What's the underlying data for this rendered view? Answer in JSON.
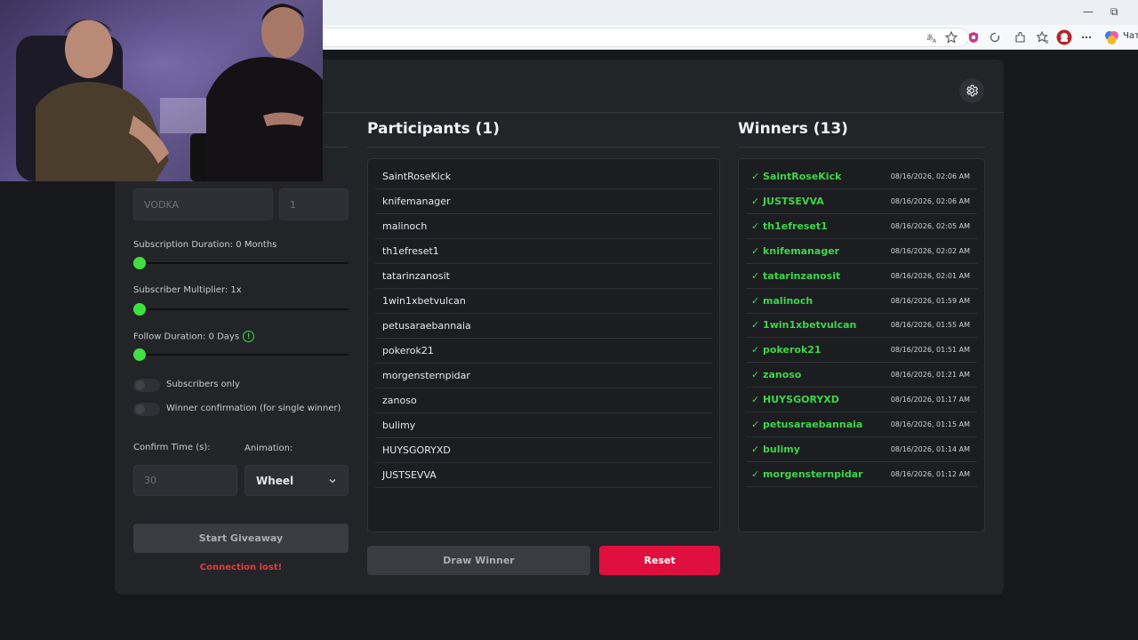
{
  "browser": {
    "window_minimize": "—",
    "window_restore": "⧉",
    "copilot_label": "Чат",
    "toolbar_icons": [
      "translate-icon",
      "favorite-star-icon",
      "extension-icon",
      "refresh-extension-icon",
      "extensions-puzzle-icon",
      "favorites-icon",
      "profile-avatar-icon",
      "more-menu-icon",
      "copilot-icon"
    ]
  },
  "left_panel": {
    "keyword_placeholder": "VODKA",
    "count_placeholder": "1",
    "subscription_duration_label": "Subscription Duration: 0 Months",
    "subscriber_multiplier_label": "Subscriber Multiplier: 1x",
    "follow_duration_label": "Follow Duration:  0  Days",
    "follow_info_badge": "!",
    "subscription_duration_value": 0,
    "subscriber_multiplier_value": 1,
    "follow_duration_value": 0,
    "subscribers_only_label": "Subscribers only",
    "subscribers_only_on": false,
    "winner_confirmation_label": "Winner confirmation (for single winner)",
    "winner_confirmation_on": false,
    "confirm_time_label": "Confirm Time (s):",
    "confirm_time_placeholder": "30",
    "animation_label": "Animation:",
    "animation_value": "Wheel",
    "start_button": "Start Giveaway",
    "status_text": "Connection lost!"
  },
  "participants": {
    "title": "Participants (1)",
    "items": [
      "SaintRoseKick",
      "knifemanager",
      "malinoch",
      "th1efreset1",
      "tatarinzanosit",
      "1win1xbetvulcan",
      "petusaraebannaia",
      "pokerok21",
      "morgensternpidar",
      "zanoso",
      "bulimy",
      "HUYSGORYXD",
      "JUSTSEVVA"
    ]
  },
  "winners": {
    "title": "Winners (13)",
    "items": [
      {
        "name": "✓ SaintRoseKick",
        "time": "08/16/2026, 02:06 AM"
      },
      {
        "name": "✓ JUSTSEVVA",
        "time": "08/16/2026, 02:06 AM"
      },
      {
        "name": "✓ th1efreset1",
        "time": "08/16/2026, 02:05 AM"
      },
      {
        "name": "✓ knifemanager",
        "time": "08/16/2026, 02:02 AM"
      },
      {
        "name": "✓ tatarinzanosit",
        "time": "08/16/2026, 02:01 AM"
      },
      {
        "name": "✓ malinoch",
        "time": "08/16/2026, 01:59 AM"
      },
      {
        "name": "✓ 1win1xbetvulcan",
        "time": "08/16/2026, 01:55 AM"
      },
      {
        "name": "✓ pokerok21",
        "time": "08/16/2026, 01:51 AM"
      },
      {
        "name": "✓ zanoso",
        "time": "08/16/2026, 01:21 AM"
      },
      {
        "name": "✓ HUYSGORYXD",
        "time": "08/16/2026, 01:17 AM"
      },
      {
        "name": "✓ petusaraebannaia",
        "time": "08/16/2026, 01:15 AM"
      },
      {
        "name": "✓ bulimy",
        "time": "08/16/2026, 01:14 AM"
      },
      {
        "name": "✓ morgensternpidar",
        "time": "08/16/2026, 01:12 AM"
      }
    ]
  },
  "actions": {
    "draw_button": "Draw Winner",
    "reset_button": "Reset"
  },
  "colors": {
    "accent_green": "#3fe03f",
    "winner_green": "#3fd54a",
    "reset_red": "#e0103e",
    "error_red": "#e53a3a",
    "card_bg": "#222428",
    "page_bg": "#16181b"
  }
}
